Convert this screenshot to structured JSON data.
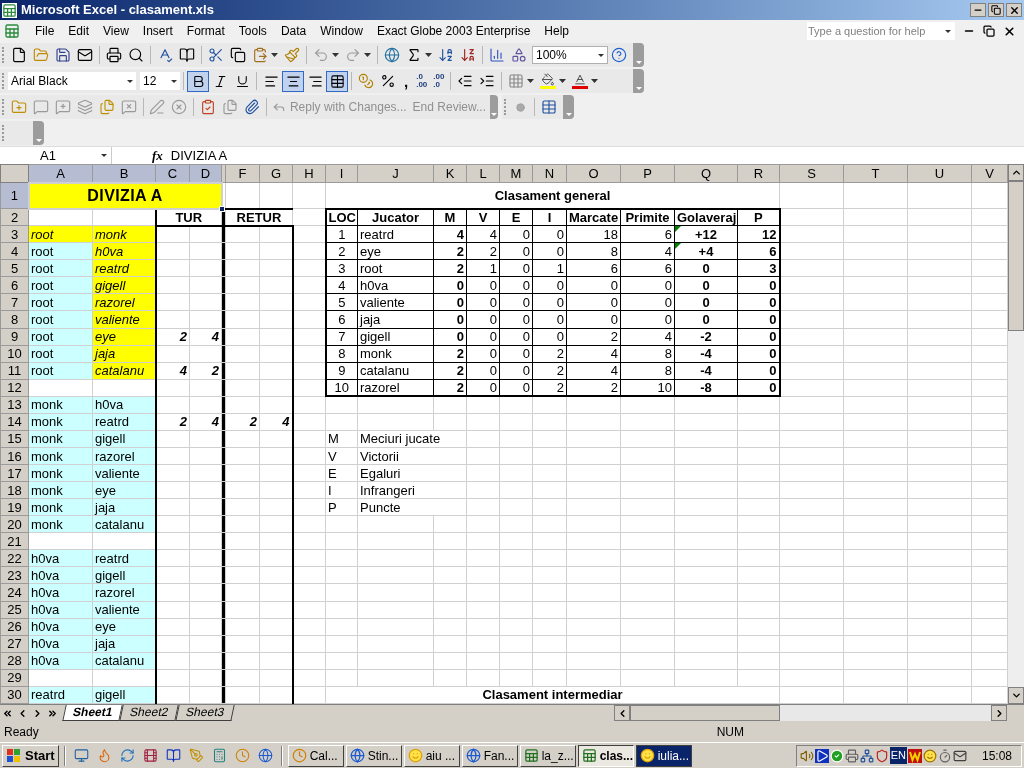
{
  "window": {
    "title": "Microsoft Excel - clasament.xls"
  },
  "menu": [
    "File",
    "Edit",
    "View",
    "Insert",
    "Format",
    "Tools",
    "Data",
    "Window",
    "Exact Globe 2003 Enterprise",
    "Help"
  ],
  "help_box": {
    "placeholder": "Type a question for help"
  },
  "formatting": {
    "font": "Arial Black",
    "size": "12",
    "zoom": "100%",
    "bold": true,
    "italic": false,
    "underline": false,
    "align_left": false,
    "align_center": true,
    "align_right": false,
    "merged": true,
    "comma": ",",
    "increase_decimal": [
      ".0",
      ".00"
    ],
    "decrease_decimal": [
      ".00",
      ".0"
    ]
  },
  "review_toolbar": [
    "Reply with Changes...",
    "End Review..."
  ],
  "formula_bar": {
    "name_box": "A1",
    "fx": "fx",
    "value": "DIVIZIA A"
  },
  "sheet": {
    "columns": [
      {
        "label": "A",
        "selected": true
      },
      {
        "label": "B",
        "selected": true
      },
      {
        "label": "C",
        "selected": true
      },
      {
        "label": "D",
        "selected": true
      },
      {
        "selected": false
      },
      {
        "label": "F",
        "selected": false
      },
      {
        "label": "G",
        "selected": false
      },
      {
        "label": "H",
        "selected": false
      },
      {
        "label": "I",
        "selected": false
      },
      {
        "label": "J",
        "selected": false
      },
      {
        "label": "K",
        "selected": false
      },
      {
        "label": "L",
        "selected": false
      },
      {
        "label": "M",
        "selected": false
      },
      {
        "label": "N",
        "selected": false
      },
      {
        "label": "O",
        "selected": false
      },
      {
        "label": "P",
        "selected": false
      },
      {
        "label": "Q",
        "selected": false
      },
      {
        "label": "R",
        "selected": false
      },
      {
        "label": "S",
        "selected": false
      },
      {
        "label": "T",
        "selected": false
      },
      {
        "label": "U",
        "selected": false
      },
      {
        "label": "V",
        "selected": false
      }
    ],
    "rows": [
      {
        "label": "1",
        "selected": true
      },
      {
        "label": "2",
        "selected": false
      },
      {
        "label": "3",
        "selected": false
      },
      {
        "label": "4",
        "selected": false
      },
      {
        "label": "5",
        "selected": false
      },
      {
        "label": "6",
        "selected": false
      },
      {
        "label": "7",
        "selected": false
      },
      {
        "label": "8",
        "selected": false
      },
      {
        "label": "9",
        "selected": false
      },
      {
        "label": "10",
        "selected": false
      },
      {
        "label": "11",
        "selected": false
      },
      {
        "label": "12",
        "selected": false
      },
      {
        "label": "13",
        "selected": false
      },
      {
        "label": "14",
        "selected": false
      },
      {
        "label": "15",
        "selected": false
      },
      {
        "label": "16",
        "selected": false
      },
      {
        "label": "17",
        "selected": false
      },
      {
        "label": "18",
        "selected": false
      },
      {
        "label": "19",
        "selected": false
      },
      {
        "label": "20",
        "selected": false
      },
      {
        "label": "21",
        "selected": false
      },
      {
        "label": "22",
        "selected": false
      },
      {
        "label": "23",
        "selected": false
      },
      {
        "label": "24",
        "selected": false
      },
      {
        "label": "25",
        "selected": false
      },
      {
        "label": "26",
        "selected": false
      },
      {
        "label": "27",
        "selected": false
      },
      {
        "label": "28",
        "selected": false
      },
      {
        "label": "29",
        "selected": false
      },
      {
        "label": "30",
        "selected": false
      }
    ],
    "title": "DIVIZIA A",
    "first_leg": "TUR",
    "second_leg": "RETUR",
    "match_groups": [
      [
        {
          "home": "root",
          "away": "monk",
          "kind": "marked-pair"
        },
        {
          "home": "root",
          "away": "h0va",
          "kind": "marked-opponent"
        },
        {
          "home": "root",
          "away": "reatrd",
          "kind": "marked-opponent"
        },
        {
          "home": "root",
          "away": "gigell",
          "kind": "marked-opponent"
        },
        {
          "home": "root",
          "away": "razorel",
          "kind": "marked-opponent"
        },
        {
          "home": "root",
          "away": "valiente",
          "kind": "marked-opponent"
        },
        {
          "home": "root",
          "away": "eye",
          "kind": "marked-opponent",
          "tur": [
            "2",
            "4"
          ]
        },
        {
          "home": "root",
          "away": "jaja",
          "kind": "marked-opponent"
        },
        {
          "home": "root",
          "away": "catalanu",
          "kind": "marked-opponent",
          "tur": [
            "4",
            "2"
          ]
        }
      ],
      [
        {
          "home": "monk",
          "away": "h0va",
          "kind": "plain"
        },
        {
          "home": "monk",
          "away": "reatrd",
          "kind": "plain",
          "tur": [
            "2",
            "4"
          ],
          "retur": [
            "2",
            "4"
          ]
        },
        {
          "home": "monk",
          "away": "gigell",
          "kind": "plain"
        },
        {
          "home": "monk",
          "away": "razorel",
          "kind": "plain"
        },
        {
          "home": "monk",
          "away": "valiente",
          "kind": "plain"
        },
        {
          "home": "monk",
          "away": "eye",
          "kind": "plain"
        },
        {
          "home": "monk",
          "away": "jaja",
          "kind": "plain"
        },
        {
          "home": "monk",
          "away": "catalanu",
          "kind": "plain"
        }
      ],
      [
        {
          "home": "h0va",
          "away": "reatrd",
          "kind": "plain"
        },
        {
          "home": "h0va",
          "away": "gigell",
          "kind": "plain"
        },
        {
          "home": "h0va",
          "away": "razorel",
          "kind": "plain"
        },
        {
          "home": "h0va",
          "away": "valiente",
          "kind": "plain"
        },
        {
          "home": "h0va",
          "away": "eye",
          "kind": "plain"
        },
        {
          "home": "h0va",
          "away": "jaja",
          "kind": "plain"
        },
        {
          "home": "h0va",
          "away": "catalanu",
          "kind": "plain"
        }
      ],
      [
        {
          "home": "reatrd",
          "away": "gigell",
          "kind": "plain"
        }
      ]
    ],
    "standings": {
      "title": "Clasament general",
      "columns": [
        "LOC",
        "Jucator",
        "M",
        "V",
        "E",
        "I",
        "Marcate",
        "Primite",
        "Golaveraj",
        "P"
      ],
      "rows": [
        {
          "cells": [
            "1",
            "reatrd",
            "4",
            "4",
            "0",
            "0",
            "18",
            "6",
            "+12",
            "12"
          ],
          "flagged": true
        },
        {
          "cells": [
            "2",
            "eye",
            "2",
            "2",
            "0",
            "0",
            "8",
            "4",
            "+4",
            "6"
          ],
          "flagged": true
        },
        {
          "cells": [
            "3",
            "root",
            "2",
            "1",
            "0",
            "1",
            "6",
            "6",
            "0",
            "3"
          ],
          "flagged": false
        },
        {
          "cells": [
            "4",
            "h0va",
            "0",
            "0",
            "0",
            "0",
            "0",
            "0",
            "0",
            "0"
          ],
          "flagged": false
        },
        {
          "cells": [
            "5",
            "valiente",
            "0",
            "0",
            "0",
            "0",
            "0",
            "0",
            "0",
            "0"
          ],
          "flagged": false
        },
        {
          "cells": [
            "6",
            "jaja",
            "0",
            "0",
            "0",
            "0",
            "0",
            "0",
            "0",
            "0"
          ],
          "flagged": false
        },
        {
          "cells": [
            "7",
            "gigell",
            "0",
            "0",
            "0",
            "0",
            "2",
            "4",
            "-2",
            "0"
          ],
          "flagged": false
        },
        {
          "cells": [
            "8",
            "monk",
            "2",
            "0",
            "0",
            "2",
            "4",
            "8",
            "-4",
            "0"
          ],
          "flagged": false
        },
        {
          "cells": [
            "9",
            "catalanu",
            "2",
            "0",
            "0",
            "2",
            "4",
            "8",
            "-4",
            "0"
          ],
          "flagged": false
        },
        {
          "cells": [
            "10",
            "razorel",
            "2",
            "0",
            "0",
            "2",
            "2",
            "10",
            "-8",
            "0"
          ],
          "flagged": false
        }
      ]
    },
    "legend": [
      {
        "key": "M",
        "text": "Meciuri jucate"
      },
      {
        "key": "V",
        "text": "Victorii"
      },
      {
        "key": "E",
        "text": "Egaluri"
      },
      {
        "key": "I",
        "text": "Infrangeri"
      },
      {
        "key": "P",
        "text": "Puncte"
      }
    ],
    "footer_title": "Clasament intermediar"
  },
  "sheet_tabs": [
    {
      "label": "Sheet1",
      "selected": true
    },
    {
      "label": "Sheet2",
      "selected": false
    },
    {
      "label": "Sheet3",
      "selected": false
    }
  ],
  "status_bar": {
    "status": "Ready",
    "indicator": "NUM"
  },
  "taskbar": {
    "start": "Start",
    "tasks": [
      {
        "label": "Cal...",
        "kind": "clock",
        "selected": false,
        "flashing": false
      },
      {
        "label": "Stin...",
        "kind": "browser",
        "selected": false,
        "flashing": false
      },
      {
        "label": "aiu ...",
        "kind": "messenger",
        "selected": false,
        "flashing": false
      },
      {
        "label": "Fan...",
        "kind": "browser",
        "selected": false,
        "flashing": false
      },
      {
        "label": "la_z...",
        "kind": "spreadsheet",
        "selected": false,
        "flashing": false
      },
      {
        "label": "clas...",
        "kind": "spreadsheet",
        "selected": true,
        "flashing": false
      },
      {
        "label": "iulia...",
        "kind": "messenger",
        "selected": false,
        "flashing": true
      }
    ],
    "language": "EN",
    "clock": "15:08"
  }
}
